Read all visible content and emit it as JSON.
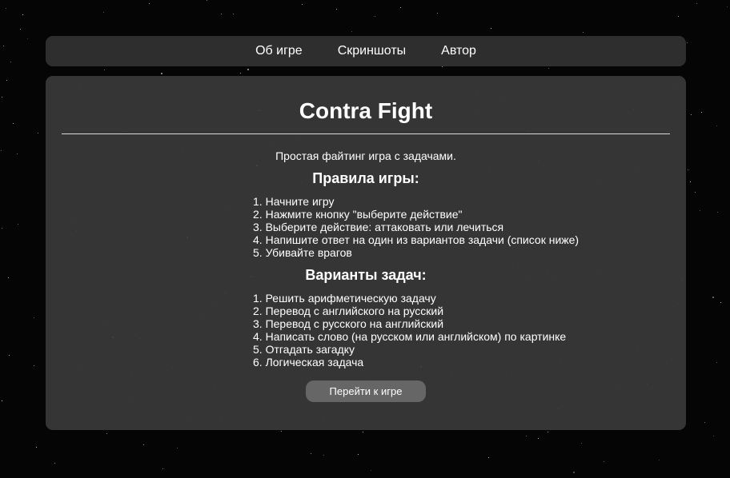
{
  "nav": {
    "items": [
      {
        "label": "Об игре"
      },
      {
        "label": "Скриншоты"
      },
      {
        "label": "Автор"
      }
    ]
  },
  "main": {
    "title": "Contra Fight",
    "tagline": "Простая файтинг игра с задачами.",
    "rules": {
      "heading": "Правила игры:",
      "items": [
        "Начните игру",
        "Нажмите кнопку \"выберите действие\"",
        "Выберите действие: аттаковать или лечиться",
        "Напишите ответ на один из вариантов задачи (список ниже)",
        "Убивайте врагов"
      ]
    },
    "tasks": {
      "heading": "Варианты задач:",
      "items": [
        "Решить арифметическую задачу",
        "Перевод с английского на русский",
        "Перевод с русского на английский",
        "Написать слово (на русском или английском) по картинке",
        "Отгадать загадку",
        "Логическая задача"
      ]
    },
    "play_button": "Перейти к игре"
  },
  "colors": {
    "background": "#050505",
    "panel": "#3a3a3a",
    "button": "#666666",
    "text": "#ffffff"
  }
}
